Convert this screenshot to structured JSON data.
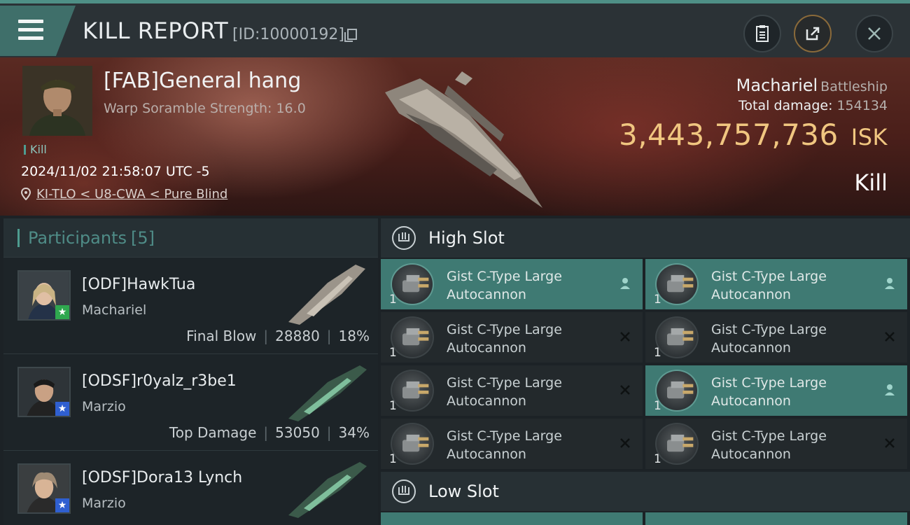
{
  "header": {
    "title": "KILL REPORT",
    "report_id": "[ID:10000192]"
  },
  "victim": {
    "name": "[FAB]General hang",
    "scramble": "Warp Soramble Strength: 16.0",
    "tag": "Kill",
    "timestamp": "2024/11/02 21:58:07 UTC -5",
    "location": "KI-TLO < U8-CWA < Pure Blind",
    "ship": "Machariel",
    "ship_class": "Battleship",
    "damage_label": "Total damage:",
    "damage_value": "154134",
    "isk_value": "3,443,757,736",
    "isk_unit": "ISK",
    "result": "Kill"
  },
  "participants": {
    "title": "Participants",
    "count": "[5]",
    "items": [
      {
        "name": "[ODF]HawkTua",
        "ship": "Machariel",
        "role": "Final Blow",
        "damage": "28880",
        "percent": "18%",
        "star_color": "#2fa84f"
      },
      {
        "name": "[ODSF]r0yalz_r3be1",
        "ship": "Marzio",
        "role": "Top Damage",
        "damage": "53050",
        "percent": "34%",
        "star_color": "#2f5fd0"
      },
      {
        "name": "[ODSF]Dora13 Lynch",
        "ship": "Marzio",
        "role": "",
        "damage": "",
        "percent": "",
        "star_color": "#2f5fd0"
      }
    ]
  },
  "slots": {
    "high_label": "High Slot",
    "low_label": "Low Slot",
    "high_modules": [
      {
        "line1": "Gist C-Type Large",
        "line2": "Autocannon",
        "qty": "1",
        "state": "person",
        "active": true
      },
      {
        "line1": "Gist C-Type Large",
        "line2": "Autocannon",
        "qty": "1",
        "state": "person",
        "active": true
      },
      {
        "line1": "Gist C-Type Large",
        "line2": "Autocannon",
        "qty": "1",
        "state": "destroyed",
        "active": false
      },
      {
        "line1": "Gist C-Type Large",
        "line2": "Autocannon",
        "qty": "1",
        "state": "destroyed",
        "active": false
      },
      {
        "line1": "Gist C-Type Large",
        "line2": "Autocannon",
        "qty": "1",
        "state": "destroyed",
        "active": false
      },
      {
        "line1": "Gist C-Type Large",
        "line2": "Autocannon",
        "qty": "1",
        "state": "person",
        "active": true
      },
      {
        "line1": "Gist C-Type Large",
        "line2": "Autocannon",
        "qty": "1",
        "state": "destroyed",
        "active": false
      },
      {
        "line1": "Gist C-Type Large",
        "line2": "Autocannon",
        "qty": "1",
        "state": "destroyed",
        "active": false
      }
    ]
  },
  "colors": {
    "accent": "#4e9c90",
    "isk": "#f0c680",
    "active_slot": "#3f7a73"
  }
}
